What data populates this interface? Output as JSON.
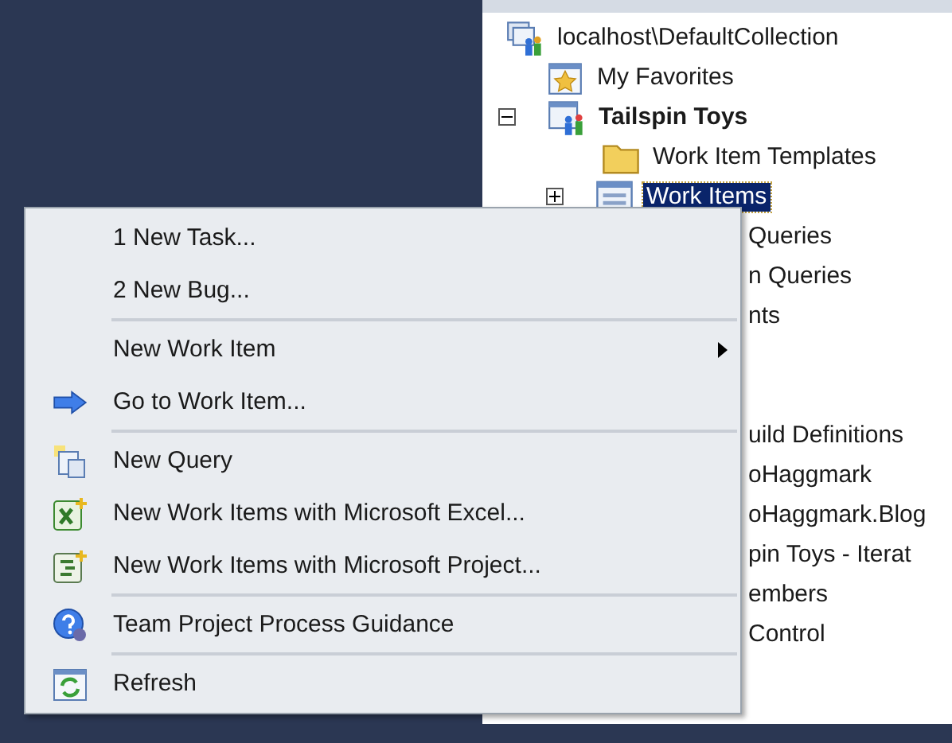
{
  "tree": {
    "root": {
      "label": "localhost\\DefaultCollection",
      "kind": "collection",
      "children": [
        {
          "label": "My Favorites",
          "kind": "favorites",
          "bold": false
        },
        {
          "label": "Tailspin Toys",
          "kind": "project",
          "bold": true,
          "expanded": true,
          "children": [
            {
              "label": "Work Item Templates",
              "kind": "folder",
              "selected": false
            },
            {
              "label": "Work Items",
              "kind": "workitems",
              "selected": true,
              "expanded": false
            }
          ]
        }
      ]
    },
    "partial_rows_upper": [
      "Queries",
      "n Queries",
      "nts"
    ],
    "partial_rows_lower": [
      "uild Definitions",
      "oHaggmark",
      "oHaggmark.Blog",
      "pin Toys - Iterat",
      "embers",
      "Control"
    ]
  },
  "context_menu": {
    "items": [
      {
        "kind": "plain",
        "label": "1 New Task...",
        "submenu": false
      },
      {
        "kind": "plain",
        "label": "2 New Bug...",
        "submenu": false
      },
      {
        "kind": "separator"
      },
      {
        "kind": "plain",
        "label": "New Work Item",
        "submenu": true
      },
      {
        "kind": "arrow",
        "label": "Go to Work Item...",
        "submenu": false
      },
      {
        "kind": "separator"
      },
      {
        "kind": "query",
        "label": "New Query",
        "submenu": false
      },
      {
        "kind": "excel",
        "label": "New Work Items with Microsoft Excel...",
        "submenu": false
      },
      {
        "kind": "project",
        "label": "New Work Items with Microsoft Project...",
        "submenu": false
      },
      {
        "kind": "separator"
      },
      {
        "kind": "help",
        "label": "Team Project Process Guidance",
        "submenu": false
      },
      {
        "kind": "separator"
      },
      {
        "kind": "refresh",
        "label": "Refresh",
        "submenu": false
      }
    ]
  }
}
